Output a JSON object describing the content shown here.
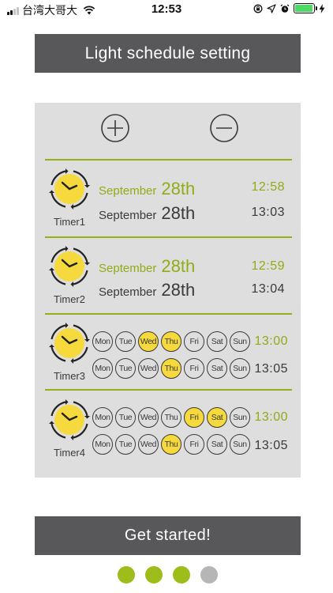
{
  "status_bar": {
    "carrier": "台湾大哥大",
    "time": "12:53",
    "battery_level": 0.95
  },
  "header": {
    "title": "Light schedule setting"
  },
  "preview": {
    "add_icon": "plus-circle-icon",
    "remove_icon": "minus-circle-icon",
    "timers": [
      {
        "label": "Timer1",
        "start": {
          "month": "September",
          "day": "28th",
          "time": "12:58"
        },
        "end": {
          "month": "September",
          "day": "28th",
          "time": "13:03"
        }
      },
      {
        "label": "Timer2",
        "start": {
          "month": "September",
          "day": "28th",
          "time": "12:59"
        },
        "end": {
          "month": "September",
          "day": "28th",
          "time": "13:04"
        }
      },
      {
        "label": "Timer3",
        "start_days": [
          {
            "name": "Mon",
            "on": false
          },
          {
            "name": "Tue",
            "on": false
          },
          {
            "name": "Wed",
            "on": true
          },
          {
            "name": "Thu",
            "on": true
          },
          {
            "name": "Fri",
            "on": false
          },
          {
            "name": "Sat",
            "on": false
          },
          {
            "name": "Sun",
            "on": false
          }
        ],
        "start_time": "13:00",
        "end_days": [
          {
            "name": "Mon",
            "on": false
          },
          {
            "name": "Tue",
            "on": false
          },
          {
            "name": "Wed",
            "on": false
          },
          {
            "name": "Thu",
            "on": true
          },
          {
            "name": "Fri",
            "on": false
          },
          {
            "name": "Sat",
            "on": false
          },
          {
            "name": "Sun",
            "on": false
          }
        ],
        "end_time": "13:05"
      },
      {
        "label": "Timer4",
        "start_days": [
          {
            "name": "Mon",
            "on": false
          },
          {
            "name": "Tue",
            "on": false
          },
          {
            "name": "Wed",
            "on": false
          },
          {
            "name": "Thu",
            "on": false
          },
          {
            "name": "Fri",
            "on": true
          },
          {
            "name": "Sat",
            "on": true
          },
          {
            "name": "Sun",
            "on": false
          }
        ],
        "start_time": "13:00",
        "end_days": [
          {
            "name": "Mon",
            "on": false
          },
          {
            "name": "Tue",
            "on": false
          },
          {
            "name": "Wed",
            "on": false
          },
          {
            "name": "Thu",
            "on": true
          },
          {
            "name": "Fri",
            "on": false
          },
          {
            "name": "Sat",
            "on": false
          },
          {
            "name": "Sun",
            "on": false
          }
        ],
        "end_time": "13:05"
      }
    ]
  },
  "actions": {
    "start_label": "Get started!"
  },
  "pager": {
    "pages": 4,
    "active": [
      true,
      true,
      true,
      false
    ]
  },
  "colors": {
    "accent_green": "#8fac17",
    "chip_yellow": "#f6d93d",
    "bar_gray": "#58585a",
    "panel_gray": "#dededf"
  }
}
